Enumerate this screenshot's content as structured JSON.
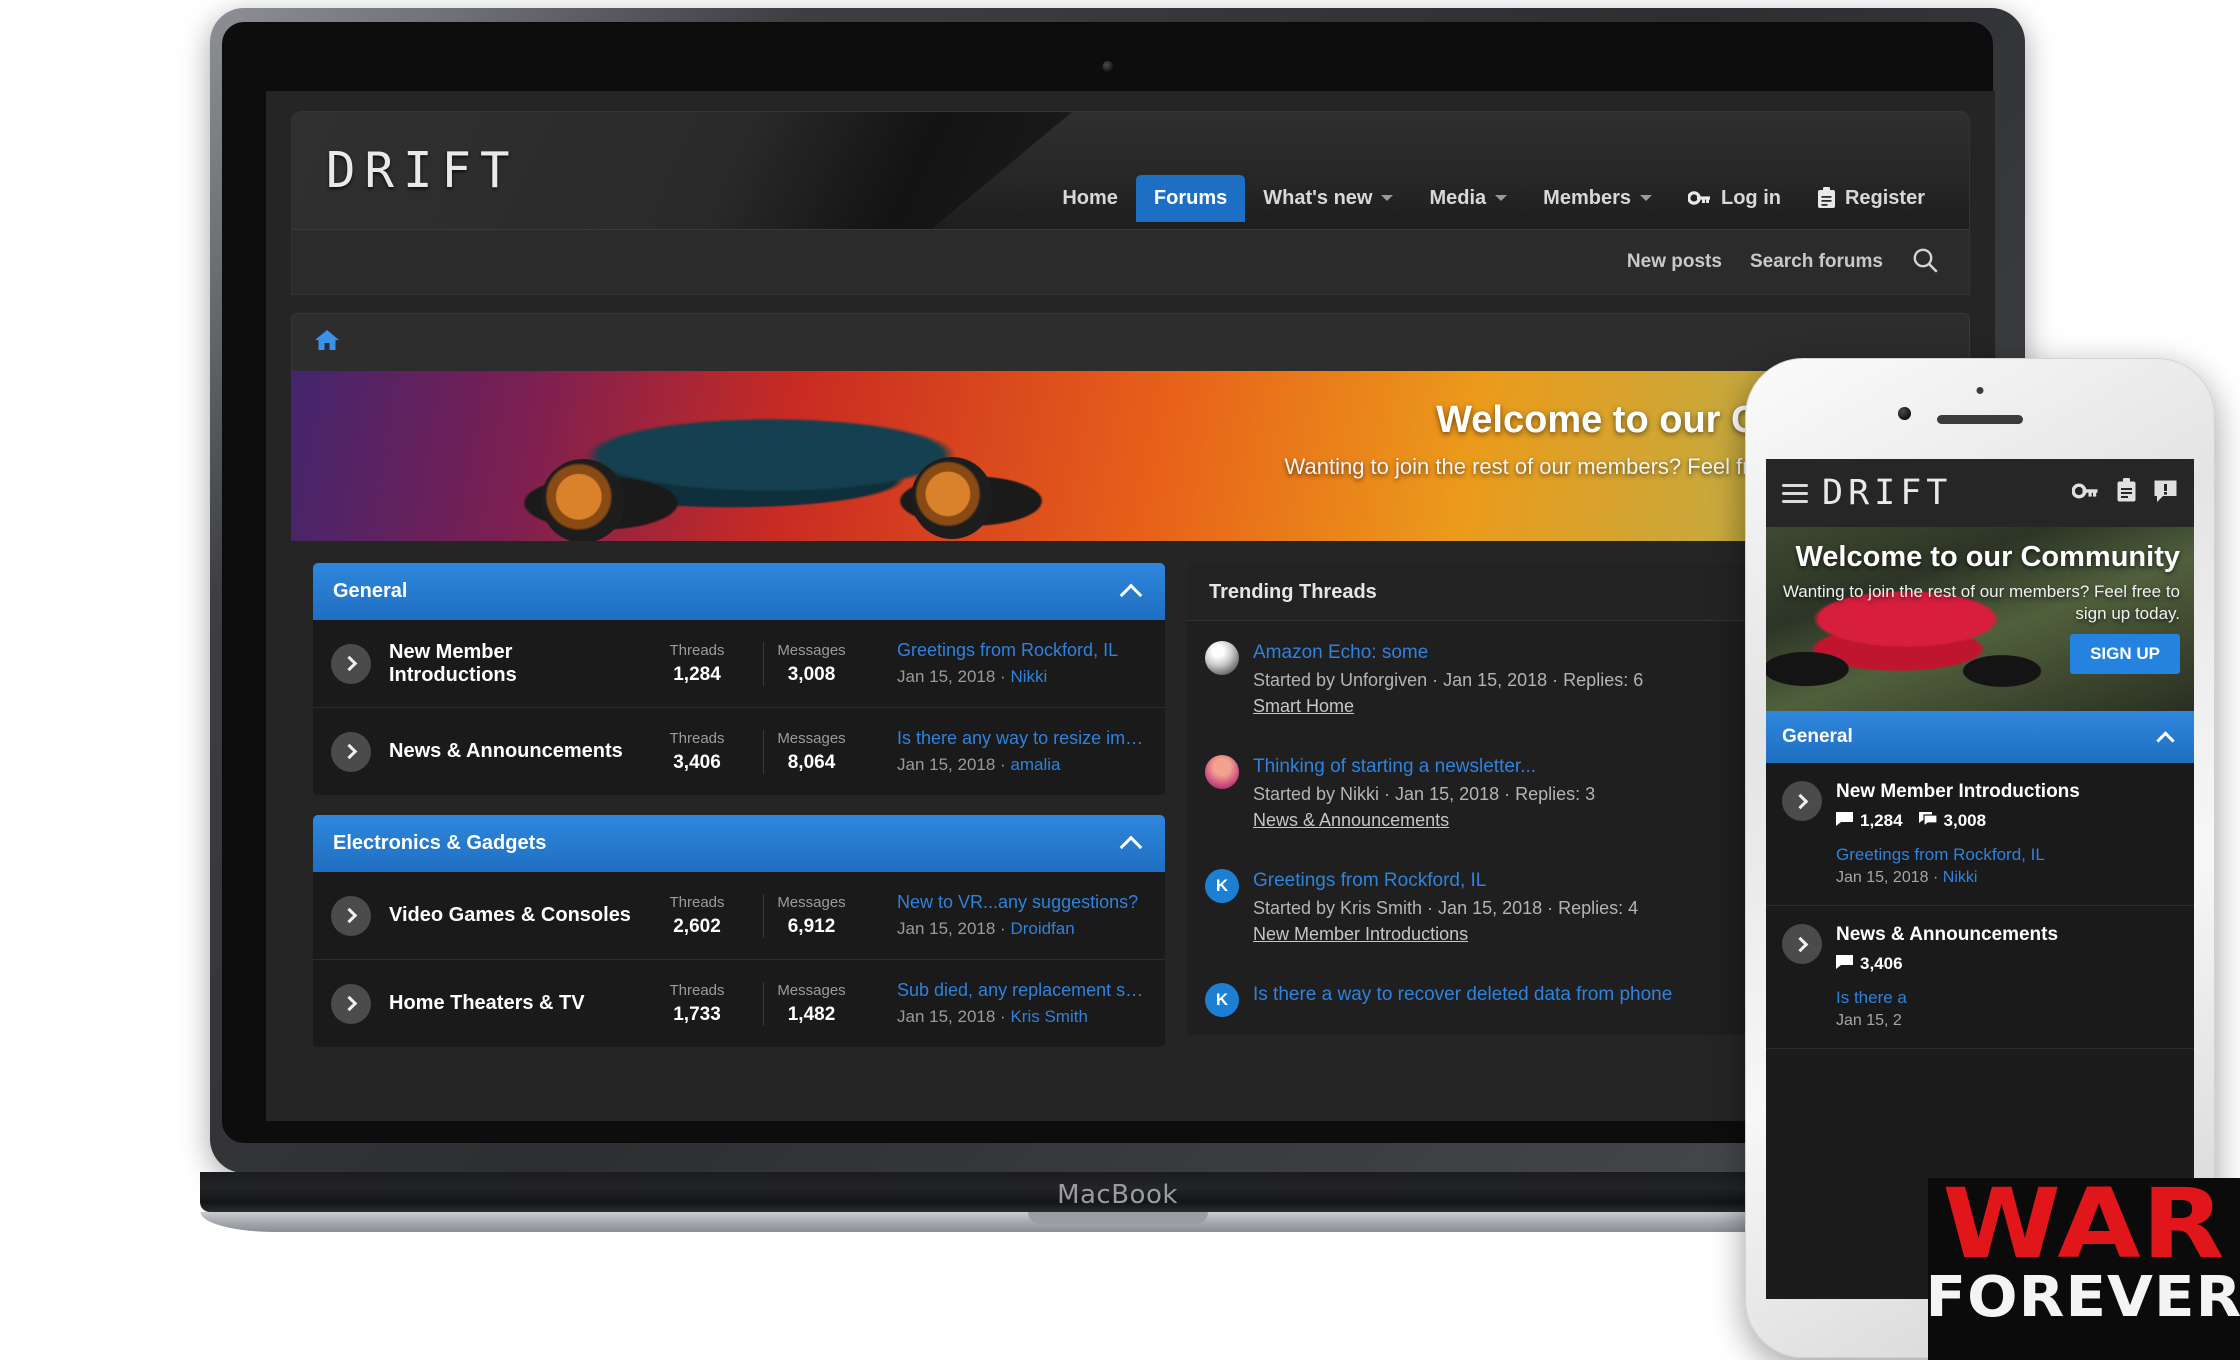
{
  "device": {
    "laptop_label": "MacBook"
  },
  "brand": {
    "logo": "DRIFT"
  },
  "nav": {
    "items": [
      {
        "label": "Home",
        "active": false,
        "caret": false
      },
      {
        "label": "Forums",
        "active": true,
        "caret": false
      },
      {
        "label": "What's new",
        "active": false,
        "caret": true
      },
      {
        "label": "Media",
        "active": false,
        "caret": true
      },
      {
        "label": "Members",
        "active": false,
        "caret": true
      }
    ],
    "login": "Log in",
    "register": "Register",
    "login_icon": "key-icon",
    "register_icon": "clipboard-icon"
  },
  "subnav": {
    "new_posts": "New posts",
    "search_forums": "Search forums",
    "search_icon": "search-icon"
  },
  "breadcrumb": {
    "home_icon": "home-icon"
  },
  "hero": {
    "title": "Welcome to our Community",
    "subtitle": "Wanting to join the rest of our members? Feel free to sign up today.",
    "button": "SIGN UP"
  },
  "forums": [
    {
      "category": "General",
      "collapse_icon": "chevron-up-icon",
      "rows": [
        {
          "icon": "chevron-right-icon",
          "title": "New Member Introductions",
          "threads_label": "Threads",
          "threads": "1,284",
          "messages_label": "Messages",
          "messages": "3,008",
          "last_title": "Greetings from Rockford, IL",
          "last_date": "Jan 15, 2018",
          "last_user": "Nikki"
        },
        {
          "icon": "chevron-right-icon",
          "title": "News & Announcements",
          "threads_label": "Threads",
          "threads": "3,406",
          "messages_label": "Messages",
          "messages": "8,064",
          "last_title": "Is there any way to resize image…",
          "last_date": "Jan 15, 2018",
          "last_user": "amalia"
        }
      ]
    },
    {
      "category": "Electronics & Gadgets",
      "collapse_icon": "chevron-up-icon",
      "rows": [
        {
          "icon": "chevron-right-icon",
          "title": "Video Games & Consoles",
          "threads_label": "Threads",
          "threads": "2,602",
          "messages_label": "Messages",
          "messages": "6,912",
          "last_title": "New to VR...any suggestions?",
          "last_date": "Jan 15, 2018",
          "last_user": "Droidfan"
        },
        {
          "icon": "chevron-right-icon",
          "title": "Home Theaters & TV",
          "threads_label": "Threads",
          "threads": "1,733",
          "messages_label": "Messages",
          "messages": "1,482",
          "last_title": "Sub died, any replacement sugg…",
          "last_date": "Jan 15, 2018",
          "last_user": "Kris Smith"
        }
      ]
    }
  ],
  "sidebar": {
    "title": "Trending Threads",
    "threads": [
      {
        "avatar_kind": "image",
        "avatar_letter": "",
        "title": "Amazon Echo: some",
        "meta": "Started by Unforgiven · Jan 15, 2018 · Replies: 6",
        "forum": "Smart Home"
      },
      {
        "avatar_kind": "pink",
        "avatar_letter": "",
        "title": "Thinking of starting a newsletter...",
        "meta": "Started by Nikki · Jan 15, 2018 · Replies: 3",
        "forum": "News & Announcements"
      },
      {
        "avatar_kind": "blue",
        "avatar_letter": "K",
        "title": "Greetings from Rockford, IL",
        "meta": "Started by Kris Smith · Jan 15, 2018 · Replies: 4",
        "forum": "New Member Introductions"
      },
      {
        "avatar_kind": "blue",
        "avatar_letter": "K",
        "title": "Is there a way to recover deleted data from phone",
        "meta": "",
        "forum": ""
      }
    ]
  },
  "mobile": {
    "logo": "DRIFT",
    "menu_icon": "hamburger-icon",
    "icons": [
      "key-icon",
      "clipboard-icon",
      "alert-icon"
    ],
    "hero_title": "Welcome to our Community",
    "hero_sub": "Wanting to join the rest of our members? Feel free to sign up today.",
    "hero_button": "SIGN UP",
    "category": "General",
    "collapse_icon": "chevron-up-icon",
    "rows": [
      {
        "icon": "chevron-right-icon",
        "title": "New Member Introductions",
        "threads": "1,284",
        "messages": "3,008",
        "threads_icon": "thread-icon",
        "messages_icon": "message-icon",
        "last_title": "Greetings from Rockford, IL",
        "last_date": "Jan 15, 2018",
        "last_user": "Nikki"
      },
      {
        "icon": "chevron-right-icon",
        "title": "News & Announcements",
        "threads": "3,406",
        "messages": "",
        "threads_icon": "thread-icon",
        "messages_icon": "message-icon",
        "last_title": "Is there a",
        "last_date": "Jan 15, 2",
        "last_user": ""
      }
    ]
  },
  "watermark": {
    "line1": "WAR",
    "line2": "FOREVER",
    "color1": "#e0161b",
    "color2": "#f4f4f4"
  }
}
